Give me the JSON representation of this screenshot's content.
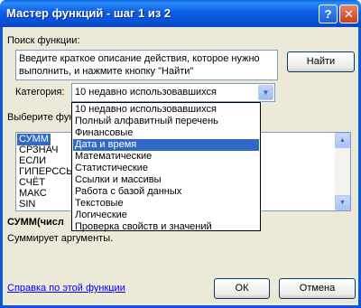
{
  "window": {
    "title": "Мастер функций - шаг 1 из 2",
    "help_glyph": "?",
    "close_glyph": "✕"
  },
  "search": {
    "label": "Поиск функции:",
    "description": "Введите краткое описание действия, которое нужно выполнить, и нажмите кнопку \"Найти\"",
    "find_button": "Найти"
  },
  "category": {
    "label": "Категория:",
    "value": "10 недавно использовавшихся",
    "options": [
      "10 недавно использовавшихся",
      "Полный алфавитный перечень",
      "Финансовые",
      "Дата и время",
      "Математические",
      "Статистические",
      "Ссылки и массивы",
      "Работа с базой данных",
      "Текстовые",
      "Логические",
      "Проверка свойств и значений"
    ],
    "highlighted": "Дата и время"
  },
  "functions": {
    "label_visible": "Выберите фун",
    "items": [
      "СУММ",
      "СРЗНАЧ",
      "ЕСЛИ",
      "ГИПЕРССЫЛ",
      "СЧЁТ",
      "МАКС",
      "SIN"
    ],
    "selected": "СУММ"
  },
  "details": {
    "syntax_visible": "СУММ(числ",
    "description": "Суммирует аргументы."
  },
  "footer": {
    "help_link": "Справка по этой функции",
    "ok": "ОК",
    "cancel": "Отмена"
  },
  "colors": {
    "titlebar": "#0a5ad8",
    "dialog_bg": "#ece9d8",
    "selection": "#316ac5",
    "link": "#0000ff"
  }
}
